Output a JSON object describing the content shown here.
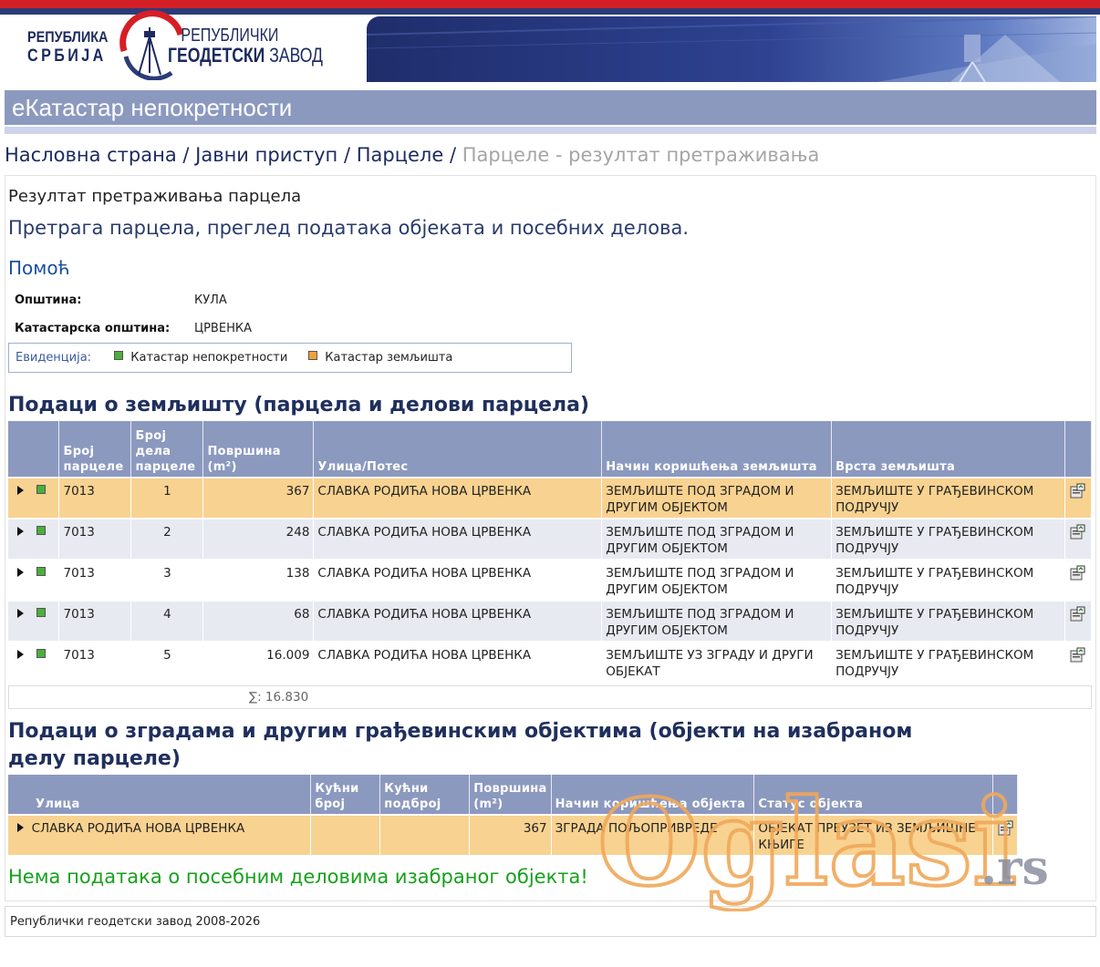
{
  "header": {
    "logo_left_line1": "РЕПУБЛИКА",
    "logo_left_line2": "СРБИЈА",
    "logo_right_line1": "РЕПУБЛИЧКИ",
    "logo_right_line2": "ГЕОДЕТСКИ",
    "logo_right_line2b": " ЗАВОД",
    "app_title": "еКатастар непокретности"
  },
  "breadcrumb": {
    "items": [
      "Насловна страна",
      "Јавни приступ",
      "Парцеле"
    ],
    "current": "Парцеле - резултат претраживања",
    "separator": " / "
  },
  "page": {
    "result_title": "Резултат претраживања парцела",
    "subtitle": "Претрага парцела, преглед података објеката и посебних делова.",
    "help_link": "Помоћ"
  },
  "info": {
    "municipality_label": "Општина:",
    "municipality_value": "КУЛА",
    "cadastral_label": "Катастарска општина:",
    "cadastral_value": "ЦРВЕНКА",
    "evidence_label": "Евиденција:",
    "evidence_items": [
      "Катастар непокретности",
      "Катастар земљишта"
    ],
    "colors": {
      "green": "#4aaf3c",
      "orange": "#f0a23a"
    }
  },
  "land": {
    "section_title": "Подаци о земљишту (парцела и делови парцела)",
    "headers": [
      "Број парцеле",
      "Број дела парцеле",
      "Површина (m²)",
      "Улица/Потес",
      "Начин коришћења земљишта",
      "Врста земљишта"
    ],
    "rows": [
      {
        "parcel": "7013",
        "part": "1",
        "area": "367",
        "street": "СЛАВКА РОДИЋА НОВА ЦРВЕНКА",
        "use": "ЗЕМЉИШТЕ ПОД ЗГРАДОМ И ДРУГИМ ОБЈЕКТОМ",
        "type": "ЗЕМЉИШТЕ У ГРАЂЕВИНСКОМ ПОДРУЧЈУ"
      },
      {
        "parcel": "7013",
        "part": "2",
        "area": "248",
        "street": "СЛАВКА РОДИЋА НОВА ЦРВЕНКА",
        "use": "ЗЕМЉИШТЕ ПОД ЗГРАДОМ И ДРУГИМ ОБЈЕКТОМ",
        "type": "ЗЕМЉИШТЕ У ГРАЂЕВИНСКОМ ПОДРУЧЈУ"
      },
      {
        "parcel": "7013",
        "part": "3",
        "area": "138",
        "street": "СЛАВКА РОДИЋА НОВА ЦРВЕНКА",
        "use": "ЗЕМЉИШТЕ ПОД ЗГРАДОМ И ДРУГИМ ОБЈЕКТОМ",
        "type": "ЗЕМЉИШТЕ У ГРАЂЕВИНСКОМ ПОДРУЧЈУ"
      },
      {
        "parcel": "7013",
        "part": "4",
        "area": "68",
        "street": "СЛАВКА РОДИЋА НОВА ЦРВЕНКА",
        "use": "ЗЕМЉИШТЕ ПОД ЗГРАДОМ И ДРУГИМ ОБЈЕКТОМ",
        "type": "ЗЕМЉИШТЕ У ГРАЂЕВИНСКОМ ПОДРУЧЈУ"
      },
      {
        "parcel": "7013",
        "part": "5",
        "area": "16.009",
        "street": "СЛАВКА РОДИЋА НОВА ЦРВЕНКА",
        "use": "ЗЕМЉИШТЕ УЗ ЗГРАДУ И ДРУГИ ОБЈЕКАТ",
        "type": "ЗЕМЉИШТЕ У ГРАЂЕВИНСКОМ ПОДРУЧЈУ"
      }
    ],
    "sum": "∑: 16.830"
  },
  "buildings": {
    "section_title_line1": "Подаци о зградама и другим грађевинским објектима (објекти на изабраном",
    "section_title_line2": "делу парцеле)",
    "headers": [
      "Улица",
      "Кућни број",
      "Кућни подброј",
      "Површина (m²)",
      "Начин коришћења објекта",
      "Статус објекта"
    ],
    "rows": [
      {
        "street": "СЛАВКА РОДИЋА НОВА ЦРВЕНКА",
        "house_no": "",
        "house_sub": "",
        "area": "367",
        "use": "ЗГРАДА ПОЉОПРИВРЕДЕ",
        "status": "ОБЈЕКАТ ПРЕУЗЕТ ИЗ ЗЕМЉИШНЕ КЊИГЕ"
      }
    ]
  },
  "no_data": "Нема података о посебним деловима изабраног објекта!",
  "footer": "Републички геодетски завод 2008-2026",
  "watermark": {
    "text": "Oglasi",
    "suffix": ".rs"
  }
}
